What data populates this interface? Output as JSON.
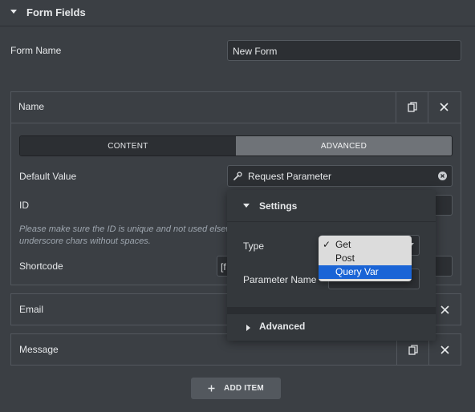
{
  "section": {
    "title": "Form Fields"
  },
  "form_name": {
    "label": "Form Name",
    "value": "New Form"
  },
  "items": [
    {
      "title": "Name",
      "tabs": {
        "content": "CONTENT",
        "advanced": "ADVANCED"
      },
      "default_value": {
        "label": "Default Value",
        "value": "Request Parameter"
      },
      "id_field": {
        "label": "ID",
        "value": ""
      },
      "hint_line1": "Please make sure the ID is unique and not used elsew",
      "hint_line2": "underscore chars without spaces.",
      "shortcode": {
        "label": "Shortcode",
        "value": "[f"
      }
    },
    {
      "title": "Email"
    },
    {
      "title": "Message"
    }
  ],
  "popover": {
    "settings_label": "Settings",
    "type_label": "Type",
    "parameter_name_label": "Parameter Name",
    "advanced_label": "Advanced"
  },
  "dropdown": {
    "options": [
      "Get",
      "Post",
      "Query Var"
    ],
    "checked": "Get",
    "highlighted": "Query Var"
  },
  "add_item": {
    "label": "ADD ITEM"
  }
}
